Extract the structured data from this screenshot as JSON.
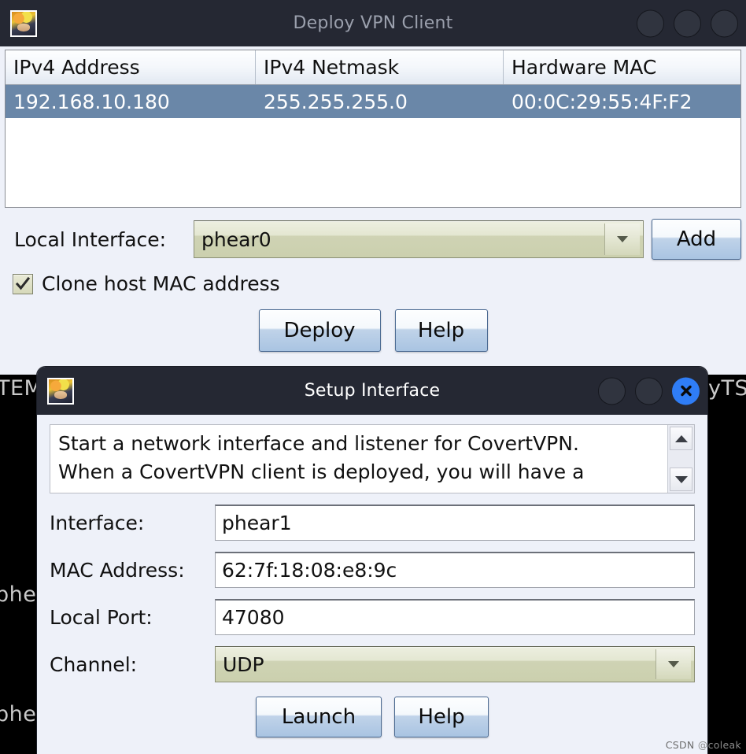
{
  "desktop": {
    "background_fragments": {
      "left_top": "TEM",
      "right_top": "yTS",
      "left_mid": "phe",
      "left_low": "phe"
    },
    "watermark_prefix": "CSDN",
    "watermark": "@coleak"
  },
  "deploy_window": {
    "title": "Deploy VPN Client",
    "icon_name": "app-icon",
    "table": {
      "columns": [
        "IPv4 Address",
        "IPv4 Netmask",
        "Hardware MAC"
      ],
      "rows": [
        {
          "ipv4_address": "192.168.10.180",
          "ipv4_netmask": "255.255.255.0",
          "hardware_mac": "00:0C:29:55:4F:F2",
          "selected": true
        }
      ]
    },
    "local_interface_label": "Local Interface:",
    "local_interface_value": "phear0",
    "add_label": "Add",
    "clone_mac_label": "Clone host MAC address",
    "clone_mac_checked": true,
    "deploy_label": "Deploy",
    "help_label": "Help"
  },
  "setup_window": {
    "title": "Setup Interface",
    "description_line1": "Start a network interface and listener for CovertVPN.",
    "description_line2": "When a CovertVPN client is deployed, you will have a",
    "fields": [
      {
        "label": "Interface:",
        "value": "phear1"
      },
      {
        "label": "MAC Address:",
        "value": "62:7f:18:08:e8:9c"
      },
      {
        "label": "Local Port:",
        "value": "47080"
      }
    ],
    "channel_label": "Channel:",
    "channel_value": "UDP",
    "launch_label": "Launch",
    "help_label": "Help"
  },
  "colors": {
    "titlebar": "#252833",
    "window_bg": "#eef1f9",
    "row_selected": "#6a87a8",
    "close_blue": "#2f7df6",
    "combo_khaki": "#cbd0ae"
  }
}
